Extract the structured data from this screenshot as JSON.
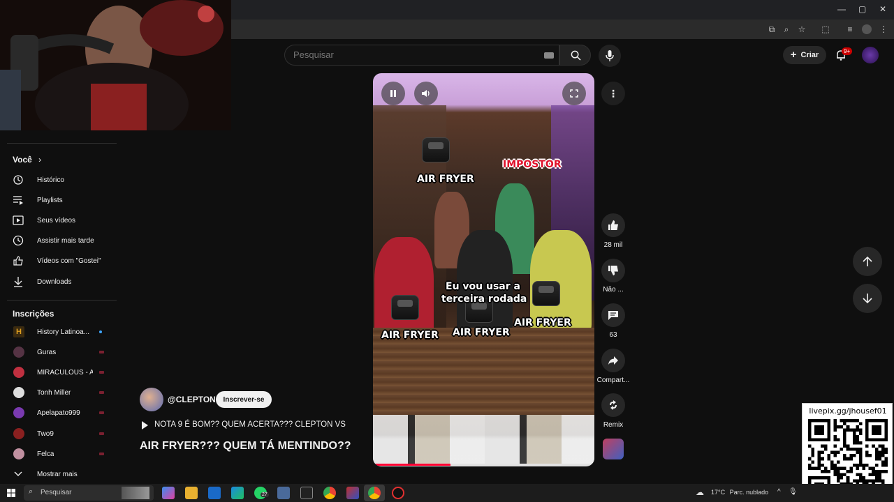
{
  "browser": {
    "window_buttons": [
      "—",
      "▢",
      "✕"
    ]
  },
  "search": {
    "placeholder": "Pesquisar"
  },
  "header": {
    "create_label": "Criar",
    "notif_badge": "9+"
  },
  "sidebar": {
    "you_heading": "Você",
    "you_items": [
      {
        "label": "Histórico",
        "icon": "history-icon"
      },
      {
        "label": "Playlists",
        "icon": "playlists-icon"
      },
      {
        "label": "Seus vídeos",
        "icon": "your-videos-icon"
      },
      {
        "label": "Assistir mais tarde",
        "icon": "watch-later-icon"
      },
      {
        "label": "Vídeos com \"Gostei\"",
        "icon": "liked-icon"
      },
      {
        "label": "Downloads",
        "icon": "download-icon"
      }
    ],
    "subs_heading": "Inscrições",
    "subscriptions": [
      {
        "label": "History Latinoa...",
        "color": "#3a2a10",
        "indicator": "new"
      },
      {
        "label": "Guras",
        "color": "#553344",
        "indicator": "live"
      },
      {
        "label": "MIRACULOUS - A...",
        "color": "#c03040",
        "indicator": "live"
      },
      {
        "label": "Tonh Miller",
        "color": "#dddddd",
        "indicator": "live"
      },
      {
        "label": "Apelapato999",
        "color": "#7a3ab0",
        "indicator": "live"
      },
      {
        "label": "Two9",
        "color": "#8a2020",
        "indicator": "live"
      },
      {
        "label": "Felca",
        "color": "#c090a0",
        "indicator": "live"
      }
    ],
    "show_more": "Mostrar mais"
  },
  "video": {
    "overlay_impostor": "IMPOSTOR",
    "overlay_fryer": "AIR FRYER",
    "overlay_caption_1": "Eu vou usar a",
    "overlay_caption_2": "terceira rodada",
    "progress": 0.35
  },
  "actions": {
    "likes": "28 mil",
    "dislike": "Não ...",
    "comments": "63",
    "share": "Compart...",
    "remix": "Remix"
  },
  "channel": {
    "handle": "@CLEPTON",
    "subscribe": "Inscrever-se",
    "title_line1": "NOTA 9 É BOM?? QUEM ACERTA??? CLEPTON VS",
    "title_line2": "AIR FRYER??? QUEM TÁ MENTINDO??"
  },
  "qr": {
    "url": "livepix.gg/jhousef01"
  },
  "taskbar": {
    "search_label": "Pesquisar",
    "weather_temp": "17°C",
    "weather_text": "Parc. nublado",
    "whatsapp_badge": "27"
  },
  "colors": {
    "accent": "#ff0033",
    "background": "#0f0f0f",
    "overlay_red": "#e0102a"
  }
}
